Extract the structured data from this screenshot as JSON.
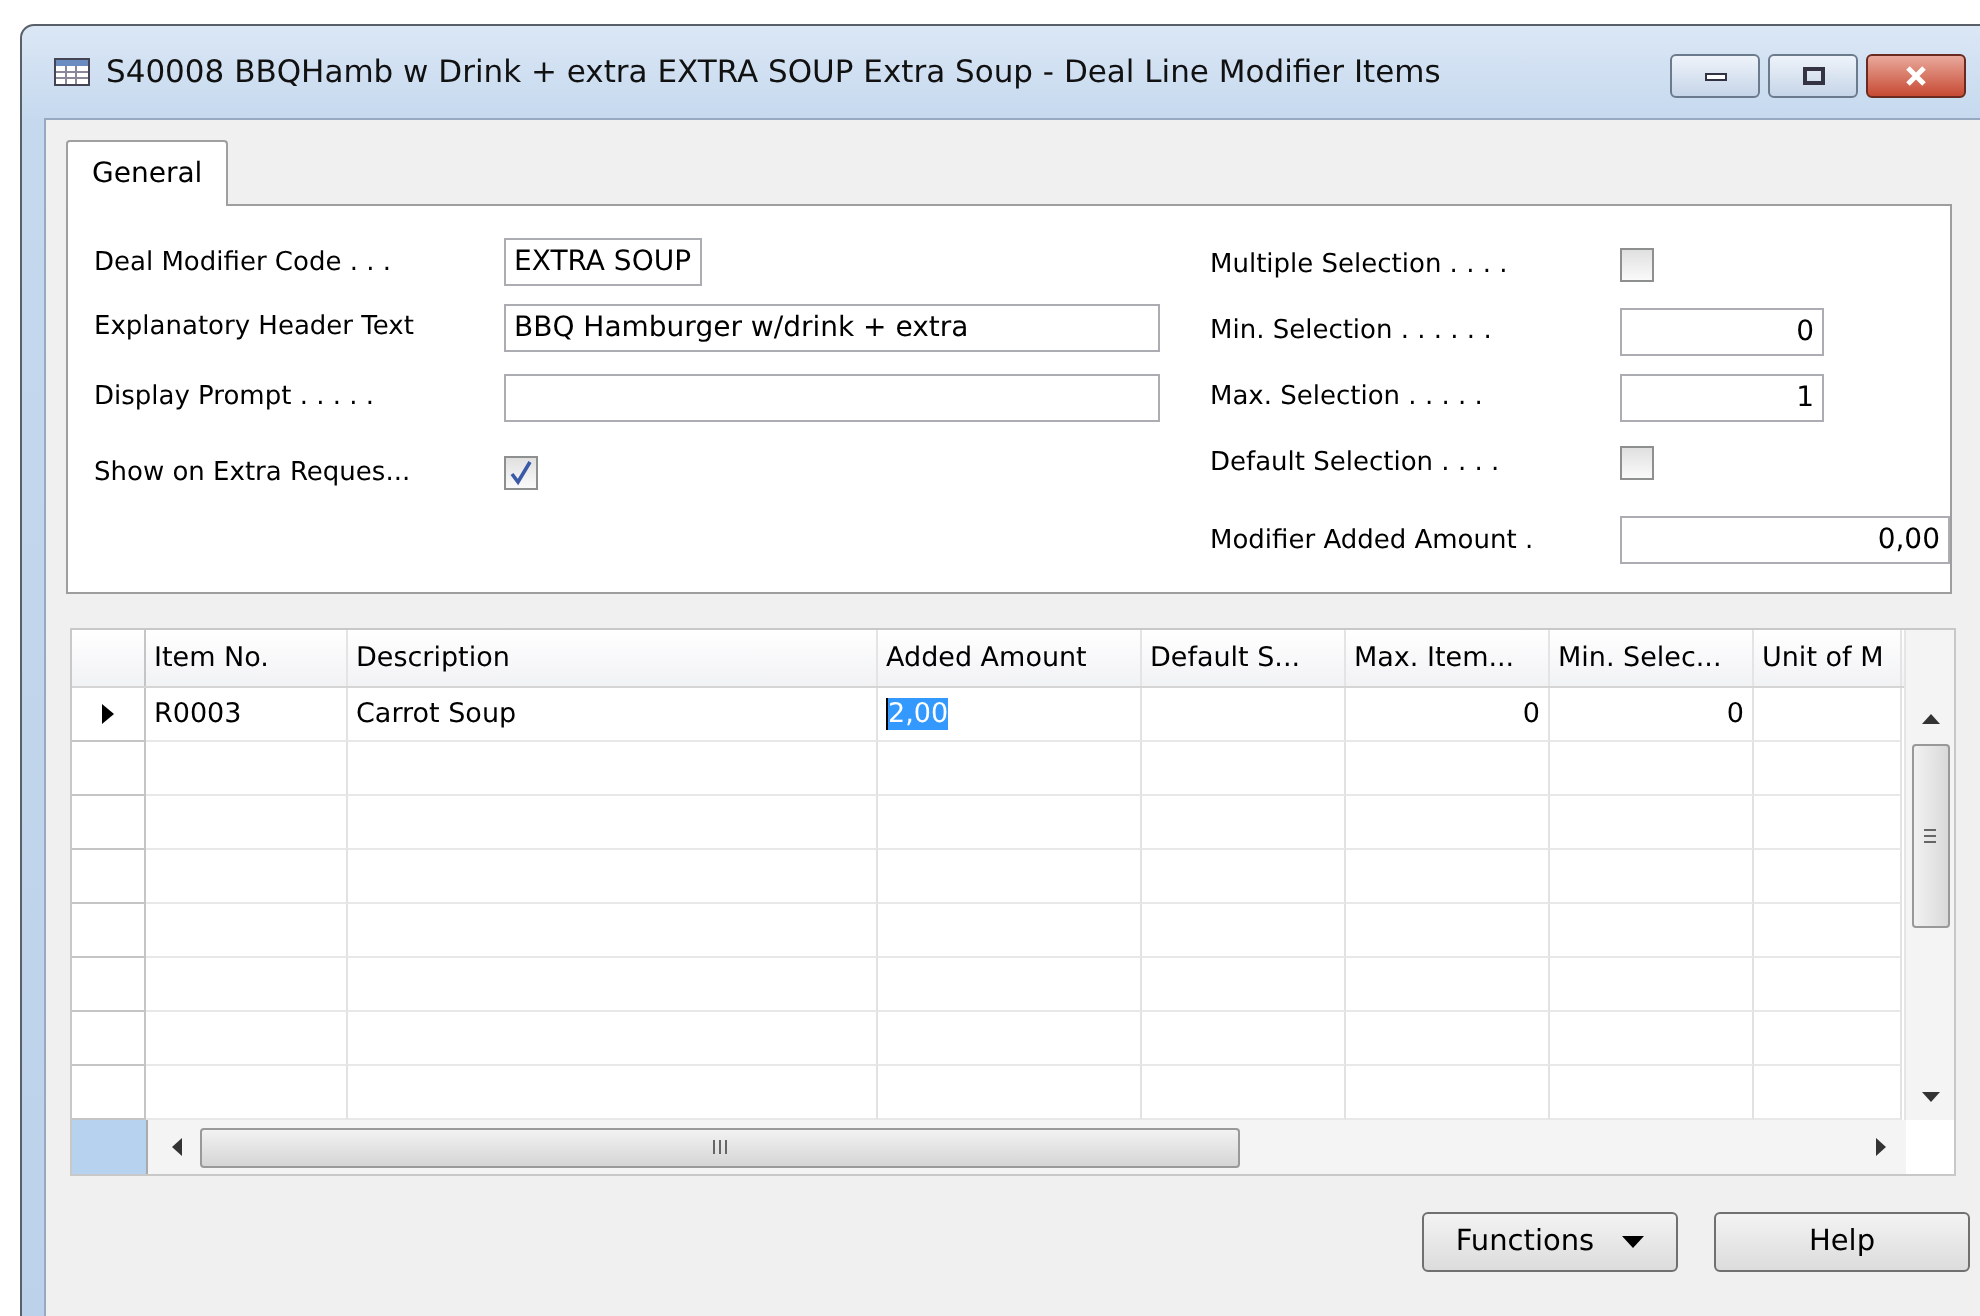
{
  "window": {
    "title": "S40008 BBQHamb w Drink + extra EXTRA SOUP Extra Soup - Deal Line Modifier Items"
  },
  "tabs": [
    {
      "label": "General",
      "selected": true
    }
  ],
  "left_fields": [
    {
      "kind": "short",
      "label": "Deal Modifier Code . . .",
      "value": "EXTRA SOUP"
    },
    {
      "kind": "text",
      "label": "Explanatory Header Text",
      "value": "BBQ Hamburger w/drink + extra"
    },
    {
      "kind": "text",
      "label": "Display Prompt . . . . ."
    },
    {
      "kind": "check",
      "label": "Show on Extra Reques...",
      "checked": true
    }
  ],
  "right_fields": [
    {
      "kind": "check",
      "label": "Multiple Selection . . . .",
      "checked": false
    },
    {
      "kind": "number",
      "label": "Min. Selection . . . . . .",
      "value": "0"
    },
    {
      "kind": "number",
      "label": "Max. Selection . . . . .",
      "value": "1"
    },
    {
      "kind": "check",
      "label": "Default Selection . . . .",
      "checked": false
    },
    {
      "kind": "amount",
      "label": "Modifier Added Amount .",
      "value": "0,00"
    }
  ],
  "table": {
    "columns": [
      {
        "label": "Item No.",
        "kind": "text"
      },
      {
        "label": "Description",
        "kind": "text"
      },
      {
        "label": "Added Amount",
        "kind": "number"
      },
      {
        "label": "Default S...",
        "kind": "text"
      },
      {
        "label": "Max. Item...",
        "kind": "number"
      },
      {
        "label": "Min. Selec...",
        "kind": "number"
      },
      {
        "label": "Unit of M",
        "kind": "text"
      }
    ],
    "rows": [
      {
        "current": true,
        "cells": [
          {
            "text": "R0003",
            "selected": false
          },
          {
            "text": "Carrot Soup",
            "selected": false
          },
          {
            "text": "2,00",
            "selected": true
          },
          {
            "selected": false
          },
          {
            "text": "0",
            "selected": false
          },
          {
            "text": "0",
            "selected": false
          },
          {
            "selected": false
          }
        ]
      }
    ]
  },
  "buttons": [
    {
      "label": "Functions",
      "kind": "menu"
    },
    {
      "label": "Help",
      "kind": "plain"
    }
  ]
}
